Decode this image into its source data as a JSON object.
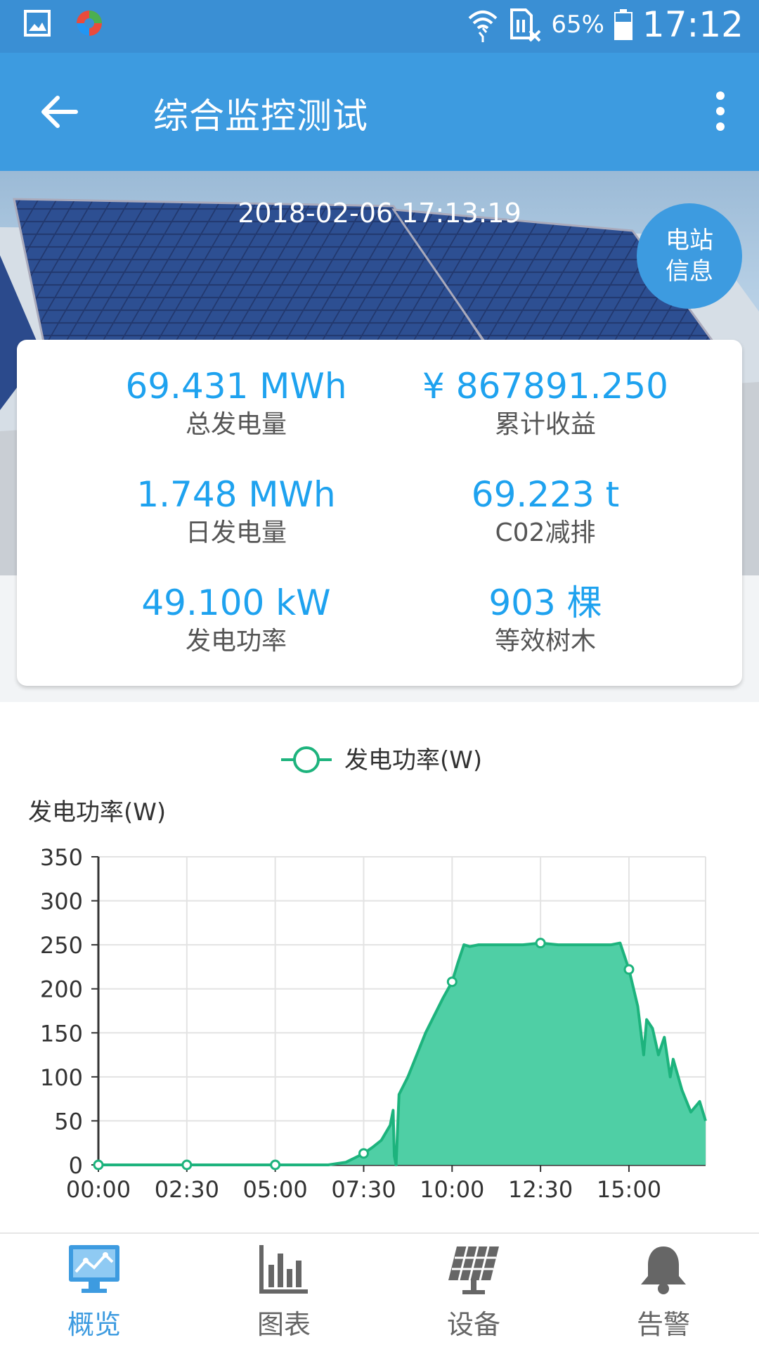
{
  "status_bar": {
    "battery": "65%",
    "time": "17:12"
  },
  "header": {
    "title": "综合监控测试"
  },
  "hero": {
    "datetime": "2018-02-06 17:13:19",
    "station_info_label": [
      "电站",
      "信息"
    ]
  },
  "stats": [
    {
      "value": "69.431 MWh",
      "label": "总发电量"
    },
    {
      "value": "¥ 867891.250",
      "label": "累计收益"
    },
    {
      "value": "1.748 MWh",
      "label": "日发电量"
    },
    {
      "value": "69.223 t",
      "label": "C02减排"
    },
    {
      "value": "49.100 kW",
      "label": "发电功率"
    },
    {
      "value": "903 棵",
      "label": "等效树木"
    }
  ],
  "nav": [
    {
      "label": "概览",
      "icon": "monitor-chart-icon",
      "active": true
    },
    {
      "label": "图表",
      "icon": "bar-chart-icon",
      "active": false
    },
    {
      "label": "设备",
      "icon": "solar-panel-icon",
      "active": false
    },
    {
      "label": "告警",
      "icon": "bell-icon",
      "active": false
    }
  ],
  "colors": {
    "primary": "#3d9be0",
    "status_bar": "#3a8fd4",
    "value_text": "#1ea2ef",
    "series_line": "#1db37d",
    "series_fill": "#4fcfa5"
  },
  "chart_data": {
    "type": "area",
    "legend": "发电功率(W)",
    "ylabel": "发电功率(W)",
    "ylim": [
      0,
      350
    ],
    "yticks": [
      0,
      50,
      100,
      150,
      200,
      250,
      300,
      350
    ],
    "xlim": [
      "00:00",
      "17:10"
    ],
    "xticks": [
      "00:00",
      "02:30",
      "05:00",
      "07:30",
      "10:00",
      "12:30",
      "15:00"
    ],
    "grid": true,
    "series": [
      {
        "name": "发电功率(W)",
        "x": [
          "00:00",
          "02:30",
          "05:00",
          "06:30",
          "07:00",
          "07:15",
          "07:30",
          "07:45",
          "08:00",
          "08:15",
          "08:20",
          "08:22",
          "08:25",
          "08:30",
          "08:45",
          "09:00",
          "09:15",
          "09:30",
          "09:45",
          "10:00",
          "10:10",
          "10:20",
          "10:30",
          "10:45",
          "11:00",
          "11:30",
          "12:00",
          "12:30",
          "13:00",
          "13:30",
          "14:00",
          "14:30",
          "14:45",
          "15:00",
          "15:15",
          "15:25",
          "15:30",
          "15:40",
          "15:50",
          "16:00",
          "16:10",
          "16:15",
          "16:30",
          "16:45",
          "17:00",
          "17:10"
        ],
        "values": [
          0,
          0,
          0,
          0,
          3,
          8,
          13,
          20,
          28,
          45,
          62,
          10,
          0,
          80,
          100,
          125,
          150,
          170,
          190,
          208,
          230,
          250,
          248,
          250,
          250,
          250,
          250,
          252,
          250,
          250,
          250,
          250,
          252,
          222,
          180,
          125,
          165,
          155,
          125,
          145,
          100,
          120,
          85,
          60,
          72,
          50
        ]
      }
    ],
    "markers": [
      {
        "x": "00:00",
        "y": 0
      },
      {
        "x": "02:30",
        "y": 0
      },
      {
        "x": "05:00",
        "y": 0
      },
      {
        "x": "07:30",
        "y": 13
      },
      {
        "x": "10:00",
        "y": 208
      },
      {
        "x": "12:30",
        "y": 252
      },
      {
        "x": "15:00",
        "y": 222
      }
    ]
  }
}
